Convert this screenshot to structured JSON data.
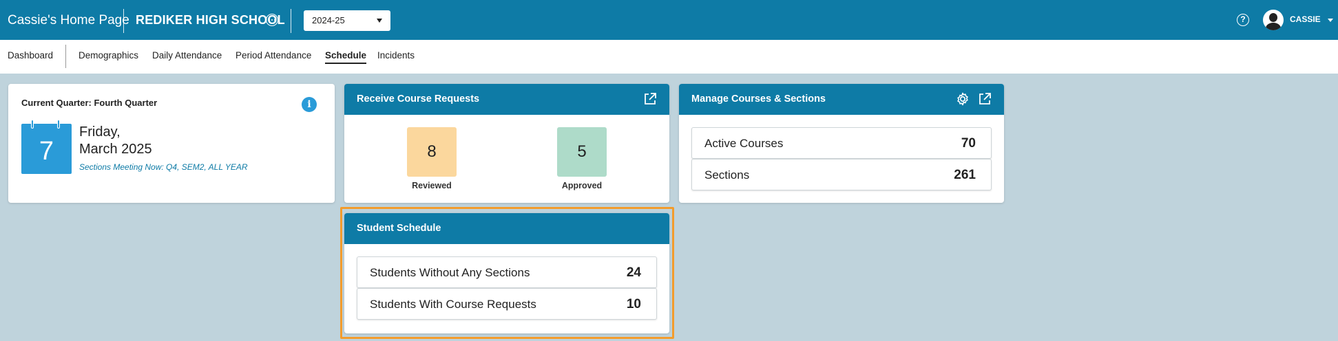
{
  "header": {
    "home_title": "Cassie's Home Page",
    "school": "REDIKER HIGH SCHOOL",
    "school_year": "2024-25",
    "user": "CASSIE",
    "bar_color": "#0e7ba6"
  },
  "nav": {
    "items": [
      {
        "label": "Dashboard",
        "active": false
      },
      {
        "label": "Demographics",
        "active": false
      },
      {
        "label": "Daily Attendance",
        "active": false
      },
      {
        "label": "Period Attendance",
        "active": false
      },
      {
        "label": "Schedule",
        "active": true
      },
      {
        "label": "Incidents",
        "active": false
      }
    ]
  },
  "current_quarter": {
    "title": "Current Quarter: Fourth Quarter",
    "day_number": "7",
    "day_line1": "Friday,",
    "day_line2": "March 2025",
    "sections_meeting": "Sections Meeting Now: Q4, SEM2, ALL YEAR"
  },
  "course_requests": {
    "title": "Receive Course Requests",
    "reviewed": {
      "value": "8",
      "label": "Reviewed",
      "color": "#fbd79d"
    },
    "approved": {
      "value": "5",
      "label": "Approved",
      "color": "#aedbc9"
    }
  },
  "manage_courses": {
    "title": "Manage Courses & Sections",
    "rows": [
      {
        "label": "Active Courses",
        "value": "70"
      },
      {
        "label": "Sections",
        "value": "261"
      }
    ]
  },
  "student_schedule": {
    "title": "Student Schedule",
    "rows": [
      {
        "label": "Students Without Any Sections",
        "value": "24"
      },
      {
        "label": "Students With Course Requests",
        "value": "10"
      }
    ],
    "highlight_color": "#f39c2c"
  }
}
